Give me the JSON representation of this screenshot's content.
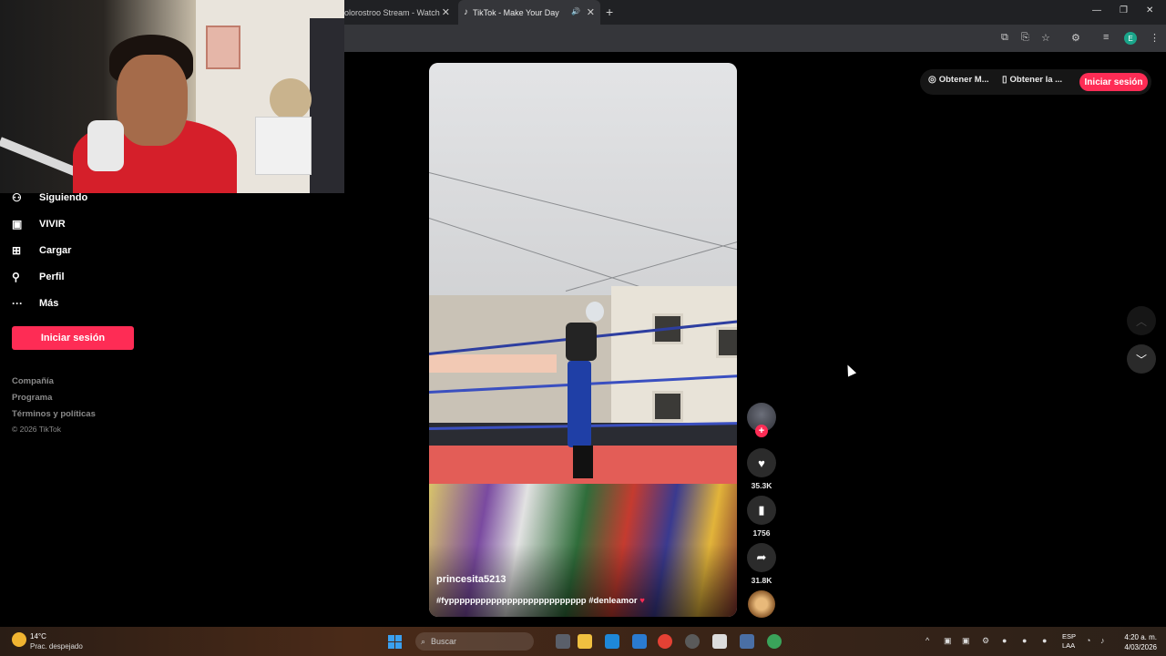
{
  "browser": {
    "tabs": [
      {
        "title": "olorostroo Stream - Watch"
      },
      {
        "title": "TikTok - Make Your Day"
      }
    ],
    "new_tab_icon": "plus-icon"
  },
  "sidebar": {
    "items": [
      {
        "label": "Siguiendo",
        "icon": "following-icon"
      },
      {
        "label": "VIVIR",
        "icon": "live-icon"
      },
      {
        "label": "Cargar",
        "icon": "upload-icon"
      },
      {
        "label": "Perfil",
        "icon": "profile-icon"
      },
      {
        "label": "Más",
        "icon": "more-icon"
      }
    ],
    "login_button": "Iniciar sesión",
    "footer_links": [
      "Compañía",
      "Programa",
      "Términos y políticas"
    ],
    "copyright": "© 2026 TikTok"
  },
  "header": {
    "get_coins": "Obtener M...",
    "get_app": "Obtener la ...",
    "login": "Iniciar sesión"
  },
  "video": {
    "username": "princesita5213",
    "caption": "#fypppppppppppppppppppppppppp #denleamor",
    "caption_emoji": "♥"
  },
  "actions": {
    "likes": "35.3K",
    "saves": "1756",
    "shares": "31.8K"
  },
  "taskbar": {
    "temperature": "14°C",
    "weather": "Prac. despejado",
    "search_placeholder": "Buscar",
    "lang_top": "ESP",
    "lang_bottom": "LAA",
    "time": "4:20 a. m.",
    "date": "4/03/2026"
  },
  "colors": {
    "brand_pink": "#fe2c55",
    "background": "#000000"
  }
}
